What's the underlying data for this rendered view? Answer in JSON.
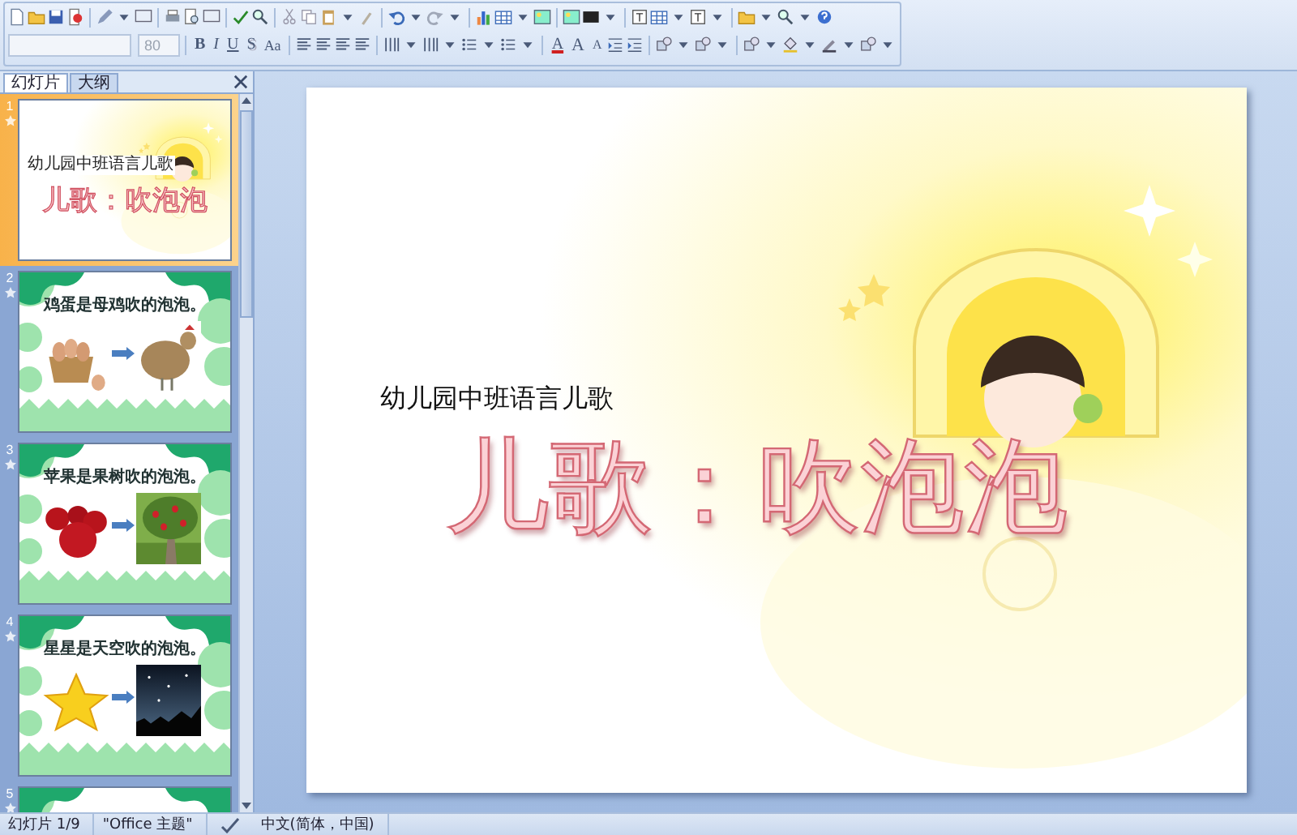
{
  "toolbar": {
    "font_size": "80",
    "format_buttons": [
      {
        "label": "B",
        "kind": "bold"
      },
      {
        "label": "I",
        "kind": "italic"
      },
      {
        "label": "U",
        "kind": "underline"
      },
      {
        "label": "S",
        "kind": "shadow"
      },
      {
        "label": "Aa",
        "kind": "case"
      }
    ],
    "font_buttons": [
      {
        "label": "A",
        "kind": "color"
      },
      {
        "label": "A",
        "kind": "grow"
      },
      {
        "label": "A",
        "kind": "shrink"
      }
    ]
  },
  "pane_tabs": [
    {
      "label": "幻灯片",
      "selected": true
    },
    {
      "label": "大纲",
      "selected": false
    }
  ],
  "slides": [
    {
      "number": "1",
      "selected": true,
      "kind": "title",
      "subtitle": "幼儿园中班语言儿歌",
      "title": "儿歌：吹泡泡"
    },
    {
      "number": "2",
      "selected": false,
      "kind": "content",
      "title": "鸡蛋是母鸡吹的泡泡。"
    },
    {
      "number": "3",
      "selected": false,
      "kind": "content",
      "title": "苹果是果树吹的泡泡。"
    },
    {
      "number": "4",
      "selected": false,
      "kind": "content",
      "title": "星星是天空吹的泡泡。"
    },
    {
      "number": "5",
      "selected": false,
      "kind": "content"
    }
  ],
  "slide": {
    "subtitle": "幼儿园中班语言儿歌",
    "title": "儿歌：吹泡泡"
  },
  "status_bar": {
    "slide_count": "幻灯片 1/9",
    "theme": "\"Office 主题\"",
    "language": "中文(简体，中国)"
  }
}
